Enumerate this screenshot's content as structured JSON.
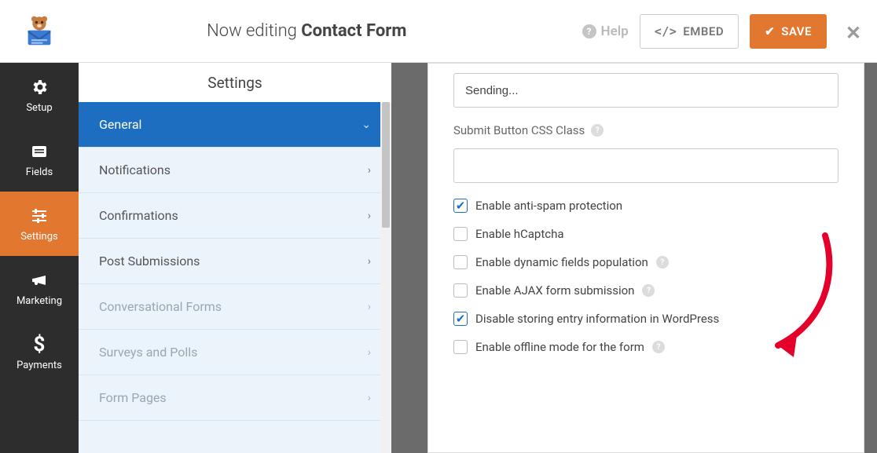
{
  "topbar": {
    "editing_prefix": "Now editing",
    "form_name": "Contact Form",
    "help_label": "Help",
    "embed_label": "EMBED",
    "save_label": "SAVE"
  },
  "rail": {
    "items": [
      {
        "icon": "gear-icon",
        "label": "Setup"
      },
      {
        "icon": "list-icon",
        "label": "Fields"
      },
      {
        "icon": "sliders-icon",
        "label": "Settings",
        "active": true
      },
      {
        "icon": "bullhorn-icon",
        "label": "Marketing"
      },
      {
        "icon": "dollar-icon",
        "label": "Payments"
      }
    ]
  },
  "sub": {
    "title": "Settings",
    "items": [
      {
        "label": "General",
        "state": "active",
        "chevron": "down"
      },
      {
        "label": "Notifications",
        "state": "normal",
        "chevron": "right"
      },
      {
        "label": "Confirmations",
        "state": "normal",
        "chevron": "right"
      },
      {
        "label": "Post Submissions",
        "state": "normal",
        "chevron": "right"
      },
      {
        "label": "Conversational Forms",
        "state": "disabled",
        "chevron": "right"
      },
      {
        "label": "Surveys and Polls",
        "state": "disabled",
        "chevron": "right"
      },
      {
        "label": "Form Pages",
        "state": "disabled",
        "chevron": "right"
      }
    ]
  },
  "panel": {
    "sending_value": "Sending...",
    "css_class_label": "Submit Button CSS Class",
    "css_class_value": "",
    "checks": [
      {
        "label": "Enable anti-spam protection",
        "checked": true,
        "hint": false
      },
      {
        "label": "Enable hCaptcha",
        "checked": false,
        "hint": false
      },
      {
        "label": "Enable dynamic fields population",
        "checked": false,
        "hint": true
      },
      {
        "label": "Enable AJAX form submission",
        "checked": false,
        "hint": true
      },
      {
        "label": "Disable storing entry information in WordPress",
        "checked": true,
        "hint": false
      },
      {
        "label": "Enable offline mode for the form",
        "checked": false,
        "hint": true
      }
    ]
  },
  "colors": {
    "accent_orange": "#e27730",
    "accent_blue": "#1d6ec1",
    "rail_bg": "#2d2d2d",
    "sub_bg": "#ebf3fb"
  }
}
